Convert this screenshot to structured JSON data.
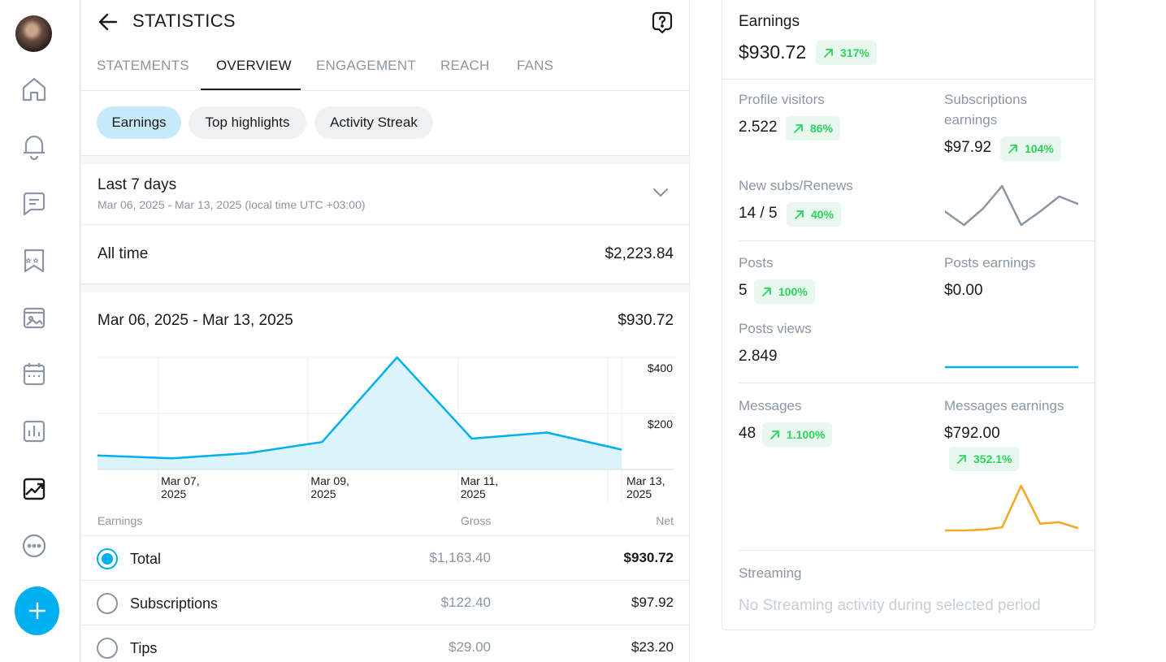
{
  "nav": {
    "items": [
      "home-icon",
      "bell-icon",
      "message-icon",
      "collections-icon",
      "vault-icon",
      "queue-icon",
      "statistics-icon",
      "trending-icon",
      "more-icon"
    ],
    "fab_icon": "plus-icon",
    "accent": "#00aff0"
  },
  "header": {
    "title": "STATISTICS"
  },
  "tabs": [
    {
      "label": "STATEMENTS"
    },
    {
      "label": "OVERVIEW"
    },
    {
      "label": "ENGAGEMENT"
    },
    {
      "label": "REACH"
    },
    {
      "label": "FANS"
    }
  ],
  "chips": [
    {
      "label": "Earnings"
    },
    {
      "label": "Top highlights"
    },
    {
      "label": "Activity Streak"
    }
  ],
  "period": {
    "title": "Last 7 days",
    "subtitle": "Mar 06, 2025 - Mar 13, 2025 (local time UTC +03:00)"
  },
  "all_time": {
    "label": "All time",
    "value": "$2,223.84"
  },
  "range": {
    "title": "Mar 06, 2025 - Mar 13, 2025",
    "value": "$930.72"
  },
  "chart_data": {
    "type": "area",
    "x": [
      "Mar 06",
      "Mar 07",
      "Mar 08",
      "Mar 09",
      "Mar 10",
      "Mar 11",
      "Mar 12",
      "Mar 13"
    ],
    "x_tick_labels": [
      [
        "Mar 07,",
        "2025"
      ],
      [
        "Mar 09,",
        "2025"
      ],
      [
        "Mar 11,",
        "2025"
      ],
      [
        "Mar 13,",
        "2025"
      ]
    ],
    "x_tick_indices": [
      1,
      3,
      5,
      7
    ],
    "values": [
      50,
      40,
      58,
      98,
      400,
      110,
      132,
      71
    ],
    "y_ticks": [
      "$400",
      "$200"
    ],
    "y_tick_values": [
      400,
      200
    ],
    "ylim": [
      0,
      400
    ],
    "color": "#00aff0",
    "fill": "#dbf3fb"
  },
  "earnings_table": {
    "headers": {
      "category": "Earnings",
      "gross": "Gross",
      "net": "Net"
    },
    "rows": [
      {
        "label": "Total",
        "gross": "$1,163.40",
        "net": "$930.72",
        "selected": true
      },
      {
        "label": "Subscriptions",
        "gross": "$122.40",
        "net": "$97.92",
        "selected": false
      },
      {
        "label": "Tips",
        "gross": "$29.00",
        "net": "$23.20",
        "selected": false
      }
    ]
  },
  "summary": {
    "earnings": {
      "label": "Earnings",
      "value": "$930.72",
      "change": "317%"
    },
    "profile_visitors": {
      "label": "Profile visitors",
      "value": "2.522",
      "change": "86%"
    },
    "subscriptions_earnings": {
      "label_line1": "Subscriptions",
      "label_line2": "earnings",
      "value": "$97.92",
      "change": "104%"
    },
    "new_subs": {
      "label": "New subs/Renews",
      "value": "14 / 5",
      "change": "40%"
    },
    "posts": {
      "label": "Posts",
      "value": "5",
      "change": "100%"
    },
    "posts_earnings": {
      "label": "Posts earnings",
      "value": "$0.00"
    },
    "posts_views": {
      "label": "Posts views",
      "value": "2.849"
    },
    "messages": {
      "label": "Messages",
      "value": "48",
      "change": "1.100%"
    },
    "messages_earnings": {
      "label": "Messages earnings",
      "value": "$792.00",
      "change": "352.1%"
    },
    "streaming": {
      "label": "Streaming",
      "empty_text": "No Streaming activity during selected period"
    },
    "positive_color": "#2bd45d",
    "positive_bg": "#e8f8ee"
  },
  "sparklines": {
    "subscriptions": {
      "values": [
        14,
        5,
        16,
        31,
        5,
        14,
        24,
        19
      ],
      "color": "#8a96a3"
    },
    "posts": {
      "values": [
        0,
        0,
        0,
        0,
        0,
        0,
        0,
        0
      ],
      "color": "#00aff0"
    },
    "messages": {
      "values": [
        0,
        0,
        1,
        4,
        60,
        9,
        11,
        3
      ],
      "color": "#f5a623"
    }
  }
}
